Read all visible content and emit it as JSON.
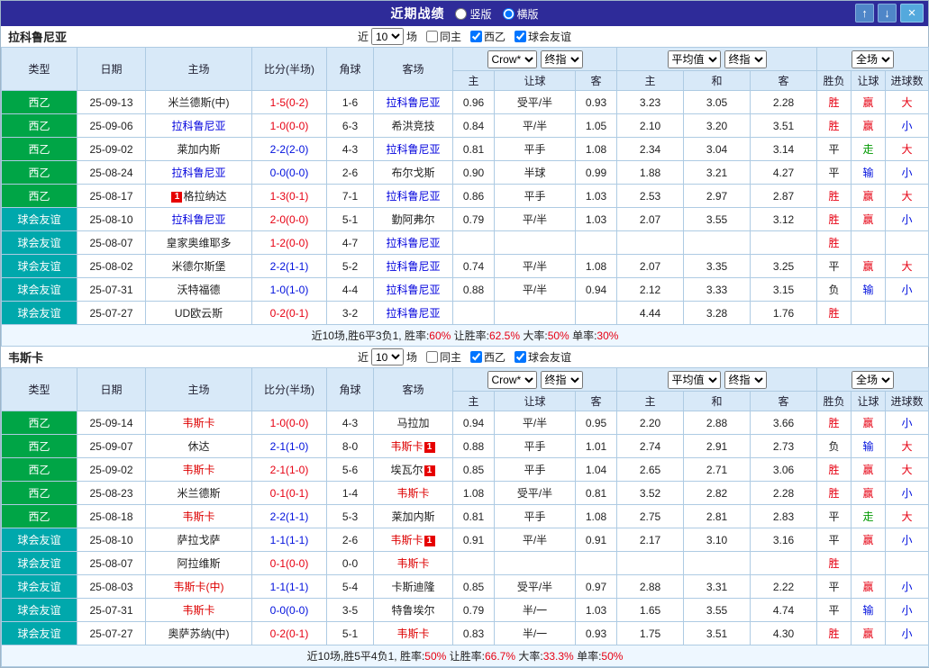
{
  "titlebar": {
    "title": "近期战绩",
    "radio_vertical": "竖版",
    "radio_horizontal": "横版",
    "selected_layout": "横版",
    "up_icon": "↑",
    "down_icon": "↓",
    "close_icon": "×"
  },
  "filter": {
    "near_label": "近",
    "games_value": "10",
    "games_label": "场",
    "checkboxes": [
      {
        "label": "同主",
        "checked": false
      },
      {
        "label": "西乙",
        "checked": true
      },
      {
        "label": "球会友谊",
        "checked": true
      }
    ]
  },
  "table_header": {
    "type": "类型",
    "date": "日期",
    "home": "主场",
    "score": "比分(半场)",
    "corners": "角球",
    "away": "客场",
    "odds_selects": [
      "Crow*",
      "终指"
    ],
    "avg_selects": [
      "平均值",
      "终指"
    ],
    "full_select": "全场",
    "odds_cols": [
      "主",
      "让球",
      "客"
    ],
    "avg_cols": [
      "主",
      "和",
      "客"
    ],
    "result_cols": [
      "胜负",
      "让球",
      "进球数"
    ]
  },
  "type_colors": {
    "西乙": "#00a546",
    "球会友谊": "#00a8ac"
  },
  "colors": {
    "red": "#e60012",
    "blue": "#0010dd",
    "green": "#009900",
    "black": "#222222"
  },
  "sections": [
    {
      "team": "拉科鲁尼亚",
      "team_color": "#0000dd",
      "rows": [
        {
          "type": "西乙",
          "date": "25-09-13",
          "home": {
            "name": "米兰德斯(中)",
            "tracked": false
          },
          "score": {
            "text": "1-5(0-2)",
            "color": "red"
          },
          "corners": "1-6",
          "away": {
            "name": "拉科鲁尼亚",
            "tracked": true
          },
          "odds": [
            "0.96",
            "受平/半",
            "0.93"
          ],
          "avg": [
            "3.23",
            "3.05",
            "2.28"
          ],
          "res": [
            {
              "t": "胜",
              "c": "red"
            },
            {
              "t": "赢",
              "c": "red"
            },
            {
              "t": "大",
              "c": "red"
            }
          ]
        },
        {
          "type": "西乙",
          "date": "25-09-06",
          "home": {
            "name": "拉科鲁尼亚",
            "tracked": true
          },
          "score": {
            "text": "1-0(0-0)",
            "color": "red"
          },
          "corners": "6-3",
          "away": {
            "name": "希洪竞技",
            "tracked": false
          },
          "odds": [
            "0.84",
            "平/半",
            "1.05"
          ],
          "avg": [
            "2.10",
            "3.20",
            "3.51"
          ],
          "res": [
            {
              "t": "胜",
              "c": "red"
            },
            {
              "t": "赢",
              "c": "red"
            },
            {
              "t": "小",
              "c": "blue"
            }
          ]
        },
        {
          "type": "西乙",
          "date": "25-09-02",
          "home": {
            "name": "莱加内斯",
            "tracked": false
          },
          "score": {
            "text": "2-2(2-0)",
            "color": "blue"
          },
          "corners": "4-3",
          "away": {
            "name": "拉科鲁尼亚",
            "tracked": true
          },
          "odds": [
            "0.81",
            "平手",
            "1.08"
          ],
          "avg": [
            "2.34",
            "3.04",
            "3.14"
          ],
          "res": [
            {
              "t": "平",
              "c": "black"
            },
            {
              "t": "走",
              "c": "green"
            },
            {
              "t": "大",
              "c": "red"
            }
          ]
        },
        {
          "type": "西乙",
          "date": "25-08-24",
          "home": {
            "name": "拉科鲁尼亚",
            "tracked": true
          },
          "score": {
            "text": "0-0(0-0)",
            "color": "blue"
          },
          "corners": "2-6",
          "away": {
            "name": "布尔戈斯",
            "tracked": false
          },
          "odds": [
            "0.90",
            "半球",
            "0.99"
          ],
          "avg": [
            "1.88",
            "3.21",
            "4.27"
          ],
          "res": [
            {
              "t": "平",
              "c": "black"
            },
            {
              "t": "输",
              "c": "blue"
            },
            {
              "t": "小",
              "c": "blue"
            }
          ]
        },
        {
          "type": "西乙",
          "date": "25-08-17",
          "home": {
            "name": "格拉纳达",
            "tracked": false,
            "badge": {
              "text": "1",
              "pos": "before"
            }
          },
          "score": {
            "text": "1-3(0-1)",
            "color": "red"
          },
          "corners": "7-1",
          "away": {
            "name": "拉科鲁尼亚",
            "tracked": true
          },
          "odds": [
            "0.86",
            "平手",
            "1.03"
          ],
          "avg": [
            "2.53",
            "2.97",
            "2.87"
          ],
          "res": [
            {
              "t": "胜",
              "c": "red"
            },
            {
              "t": "赢",
              "c": "red"
            },
            {
              "t": "大",
              "c": "red"
            }
          ]
        },
        {
          "type": "球会友谊",
          "date": "25-08-10",
          "home": {
            "name": "拉科鲁尼亚",
            "tracked": true
          },
          "score": {
            "text": "2-0(0-0)",
            "color": "red"
          },
          "corners": "5-1",
          "away": {
            "name": "勤阿弗尔",
            "tracked": false
          },
          "odds": [
            "0.79",
            "平/半",
            "1.03"
          ],
          "avg": [
            "2.07",
            "3.55",
            "3.12"
          ],
          "res": [
            {
              "t": "胜",
              "c": "red"
            },
            {
              "t": "赢",
              "c": "red"
            },
            {
              "t": "小",
              "c": "blue"
            }
          ]
        },
        {
          "type": "球会友谊",
          "date": "25-08-07",
          "home": {
            "name": "皇家奥维耶多",
            "tracked": false
          },
          "score": {
            "text": "1-2(0-0)",
            "color": "red"
          },
          "corners": "4-7",
          "away": {
            "name": "拉科鲁尼亚",
            "tracked": true
          },
          "odds": [
            "",
            "",
            ""
          ],
          "avg": [
            "",
            "",
            ""
          ],
          "res": [
            {
              "t": "胜",
              "c": "red"
            },
            {
              "t": "",
              "c": "black"
            },
            {
              "t": "",
              "c": "black"
            }
          ]
        },
        {
          "type": "球会友谊",
          "date": "25-08-02",
          "home": {
            "name": "米德尔斯堡",
            "tracked": false
          },
          "score": {
            "text": "2-2(1-1)",
            "color": "blue"
          },
          "corners": "5-2",
          "away": {
            "name": "拉科鲁尼亚",
            "tracked": true
          },
          "odds": [
            "0.74",
            "平/半",
            "1.08"
          ],
          "avg": [
            "2.07",
            "3.35",
            "3.25"
          ],
          "res": [
            {
              "t": "平",
              "c": "black"
            },
            {
              "t": "赢",
              "c": "red"
            },
            {
              "t": "大",
              "c": "red"
            }
          ]
        },
        {
          "type": "球会友谊",
          "date": "25-07-31",
          "home": {
            "name": "沃特福德",
            "tracked": false
          },
          "score": {
            "text": "1-0(1-0)",
            "color": "blue"
          },
          "corners": "4-4",
          "away": {
            "name": "拉科鲁尼亚",
            "tracked": true
          },
          "odds": [
            "0.88",
            "平/半",
            "0.94"
          ],
          "avg": [
            "2.12",
            "3.33",
            "3.15"
          ],
          "res": [
            {
              "t": "负",
              "c": "black"
            },
            {
              "t": "输",
              "c": "blue"
            },
            {
              "t": "小",
              "c": "blue"
            }
          ]
        },
        {
          "type": "球会友谊",
          "date": "25-07-27",
          "home": {
            "name": "UD欧云斯",
            "tracked": false
          },
          "score": {
            "text": "0-2(0-1)",
            "color": "red"
          },
          "corners": "3-2",
          "away": {
            "name": "拉科鲁尼亚",
            "tracked": true
          },
          "odds": [
            "",
            "",
            ""
          ],
          "avg": [
            "4.44",
            "3.28",
            "1.76"
          ],
          "res": [
            {
              "t": "胜",
              "c": "red"
            },
            {
              "t": "",
              "c": "black"
            },
            {
              "t": "",
              "c": "black"
            }
          ]
        }
      ],
      "summary": [
        {
          "t": "近10场,胜6平3负1, ",
          "c": "black"
        },
        {
          "t": "胜率:",
          "c": "black"
        },
        {
          "t": "60%",
          "c": "red"
        },
        {
          "t": " 让胜率:",
          "c": "black"
        },
        {
          "t": "62.5%",
          "c": "red"
        },
        {
          "t": " 大率:",
          "c": "black"
        },
        {
          "t": "50%",
          "c": "red"
        },
        {
          "t": " 单率:",
          "c": "black"
        },
        {
          "t": "30%",
          "c": "red"
        }
      ]
    },
    {
      "team": "韦斯卡",
      "team_color": "#dd0000",
      "rows": [
        {
          "type": "西乙",
          "date": "25-09-14",
          "home": {
            "name": "韦斯卡",
            "tracked": true
          },
          "score": {
            "text": "1-0(0-0)",
            "color": "red"
          },
          "corners": "4-3",
          "away": {
            "name": "马拉加",
            "tracked": false
          },
          "odds": [
            "0.94",
            "平/半",
            "0.95"
          ],
          "avg": [
            "2.20",
            "2.88",
            "3.66"
          ],
          "res": [
            {
              "t": "胜",
              "c": "red"
            },
            {
              "t": "赢",
              "c": "red"
            },
            {
              "t": "小",
              "c": "blue"
            }
          ]
        },
        {
          "type": "西乙",
          "date": "25-09-07",
          "home": {
            "name": "休达",
            "tracked": false
          },
          "score": {
            "text": "2-1(1-0)",
            "color": "blue"
          },
          "corners": "8-0",
          "away": {
            "name": "韦斯卡",
            "tracked": true,
            "badge": {
              "text": "1",
              "pos": "after"
            }
          },
          "odds": [
            "0.88",
            "平手",
            "1.01"
          ],
          "avg": [
            "2.74",
            "2.91",
            "2.73"
          ],
          "res": [
            {
              "t": "负",
              "c": "black"
            },
            {
              "t": "输",
              "c": "blue"
            },
            {
              "t": "大",
              "c": "red"
            }
          ]
        },
        {
          "type": "西乙",
          "date": "25-09-02",
          "home": {
            "name": "韦斯卡",
            "tracked": true
          },
          "score": {
            "text": "2-1(1-0)",
            "color": "red"
          },
          "corners": "5-6",
          "away": {
            "name": "埃瓦尔",
            "tracked": false,
            "badge": {
              "text": "1",
              "pos": "after"
            }
          },
          "odds": [
            "0.85",
            "平手",
            "1.04"
          ],
          "avg": [
            "2.65",
            "2.71",
            "3.06"
          ],
          "res": [
            {
              "t": "胜",
              "c": "red"
            },
            {
              "t": "赢",
              "c": "red"
            },
            {
              "t": "大",
              "c": "red"
            }
          ]
        },
        {
          "type": "西乙",
          "date": "25-08-23",
          "home": {
            "name": "米兰德斯",
            "tracked": false
          },
          "score": {
            "text": "0-1(0-1)",
            "color": "red"
          },
          "corners": "1-4",
          "away": {
            "name": "韦斯卡",
            "tracked": true
          },
          "odds": [
            "1.08",
            "受平/半",
            "0.81"
          ],
          "avg": [
            "3.52",
            "2.82",
            "2.28"
          ],
          "res": [
            {
              "t": "胜",
              "c": "red"
            },
            {
              "t": "赢",
              "c": "red"
            },
            {
              "t": "小",
              "c": "blue"
            }
          ]
        },
        {
          "type": "西乙",
          "date": "25-08-18",
          "home": {
            "name": "韦斯卡",
            "tracked": true
          },
          "score": {
            "text": "2-2(1-1)",
            "color": "blue"
          },
          "corners": "5-3",
          "away": {
            "name": "莱加内斯",
            "tracked": false
          },
          "odds": [
            "0.81",
            "平手",
            "1.08"
          ],
          "avg": [
            "2.75",
            "2.81",
            "2.83"
          ],
          "res": [
            {
              "t": "平",
              "c": "black"
            },
            {
              "t": "走",
              "c": "green"
            },
            {
              "t": "大",
              "c": "red"
            }
          ]
        },
        {
          "type": "球会友谊",
          "date": "25-08-10",
          "home": {
            "name": "萨拉戈萨",
            "tracked": false
          },
          "score": {
            "text": "1-1(1-1)",
            "color": "blue"
          },
          "corners": "2-6",
          "away": {
            "name": "韦斯卡",
            "tracked": true,
            "badge": {
              "text": "1",
              "pos": "after"
            }
          },
          "odds": [
            "0.91",
            "平/半",
            "0.91"
          ],
          "avg": [
            "2.17",
            "3.10",
            "3.16"
          ],
          "res": [
            {
              "t": "平",
              "c": "black"
            },
            {
              "t": "赢",
              "c": "red"
            },
            {
              "t": "小",
              "c": "blue"
            }
          ]
        },
        {
          "type": "球会友谊",
          "date": "25-08-07",
          "home": {
            "name": "阿拉维斯",
            "tracked": false
          },
          "score": {
            "text": "0-1(0-0)",
            "color": "red"
          },
          "corners": "0-0",
          "away": {
            "name": "韦斯卡",
            "tracked": true
          },
          "odds": [
            "",
            "",
            ""
          ],
          "avg": [
            "",
            "",
            ""
          ],
          "res": [
            {
              "t": "胜",
              "c": "red"
            },
            {
              "t": "",
              "c": "black"
            },
            {
              "t": "",
              "c": "black"
            }
          ]
        },
        {
          "type": "球会友谊",
          "date": "25-08-03",
          "home": {
            "name": "韦斯卡(中)",
            "tracked": true
          },
          "score": {
            "text": "1-1(1-1)",
            "color": "blue"
          },
          "corners": "5-4",
          "away": {
            "name": "卡斯迪隆",
            "tracked": false
          },
          "odds": [
            "0.85",
            "受平/半",
            "0.97"
          ],
          "avg": [
            "2.88",
            "3.31",
            "2.22"
          ],
          "res": [
            {
              "t": "平",
              "c": "black"
            },
            {
              "t": "赢",
              "c": "red"
            },
            {
              "t": "小",
              "c": "blue"
            }
          ]
        },
        {
          "type": "球会友谊",
          "date": "25-07-31",
          "home": {
            "name": "韦斯卡",
            "tracked": true
          },
          "score": {
            "text": "0-0(0-0)",
            "color": "blue"
          },
          "corners": "3-5",
          "away": {
            "name": "特鲁埃尔",
            "tracked": false
          },
          "odds": [
            "0.79",
            "半/一",
            "1.03"
          ],
          "avg": [
            "1.65",
            "3.55",
            "4.74"
          ],
          "res": [
            {
              "t": "平",
              "c": "black"
            },
            {
              "t": "输",
              "c": "blue"
            },
            {
              "t": "小",
              "c": "blue"
            }
          ]
        },
        {
          "type": "球会友谊",
          "date": "25-07-27",
          "home": {
            "name": "奥萨苏纳(中)",
            "tracked": false
          },
          "score": {
            "text": "0-2(0-1)",
            "color": "red"
          },
          "corners": "5-1",
          "away": {
            "name": "韦斯卡",
            "tracked": true
          },
          "odds": [
            "0.83",
            "半/一",
            "0.93"
          ],
          "avg": [
            "1.75",
            "3.51",
            "4.30"
          ],
          "res": [
            {
              "t": "胜",
              "c": "red"
            },
            {
              "t": "赢",
              "c": "red"
            },
            {
              "t": "小",
              "c": "blue"
            }
          ]
        }
      ],
      "summary": [
        {
          "t": "近10场,胜5平4负1, ",
          "c": "black"
        },
        {
          "t": "胜率:",
          "c": "black"
        },
        {
          "t": "50%",
          "c": "red"
        },
        {
          "t": " 让胜率:",
          "c": "black"
        },
        {
          "t": "66.7%",
          "c": "red"
        },
        {
          "t": " 大率:",
          "c": "black"
        },
        {
          "t": "33.3%",
          "c": "red"
        },
        {
          "t": " 单率:",
          "c": "black"
        },
        {
          "t": "50%",
          "c": "red"
        }
      ]
    }
  ]
}
